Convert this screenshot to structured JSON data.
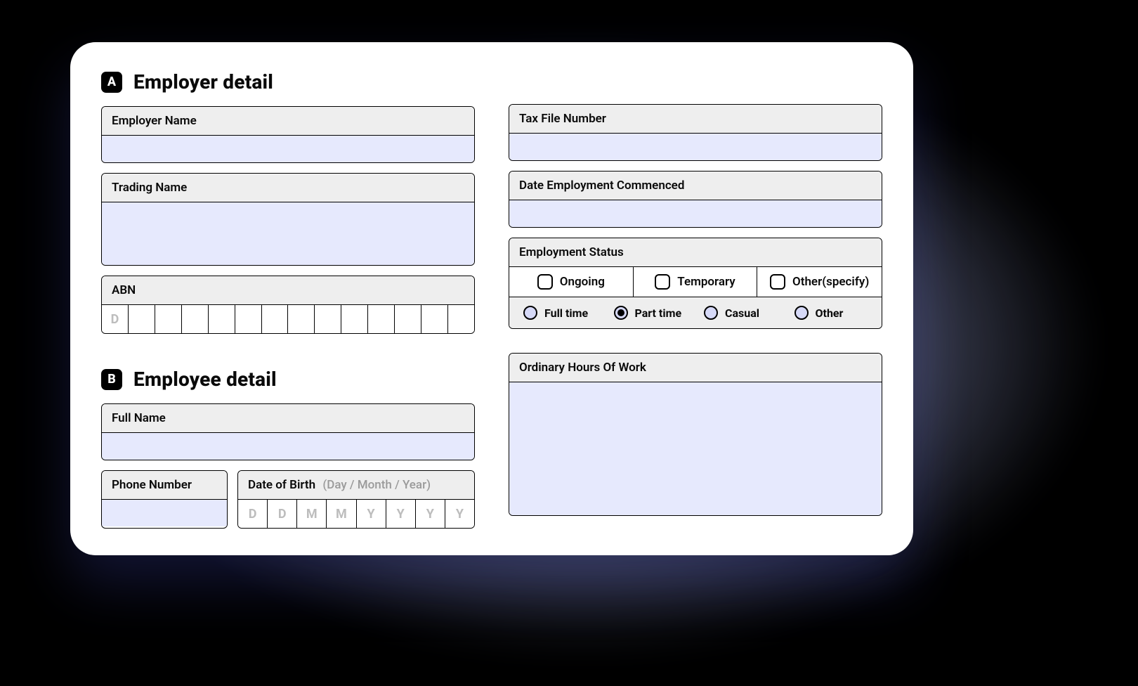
{
  "sections": {
    "A": {
      "badge": "A",
      "title": "Employer detail"
    },
    "B": {
      "badge": "B",
      "title": "Employee detail"
    }
  },
  "fields": {
    "employerName": {
      "label": "Employer Name",
      "value": ""
    },
    "tradingName": {
      "label": "Trading Name",
      "value": ""
    },
    "abn": {
      "label": "ABN",
      "placeholder0": "D"
    },
    "taxFileNumber": {
      "label": "Tax File Number",
      "value": ""
    },
    "dateCommenced": {
      "label": "Date Employment Commenced",
      "value": ""
    },
    "employmentStatus": {
      "label": "Employment Status",
      "checks": [
        {
          "label": "Ongoing",
          "checked": false
        },
        {
          "label": "Temporary",
          "checked": false
        },
        {
          "label": "Other(specify)",
          "checked": false
        }
      ],
      "radios": [
        {
          "label": "Full time",
          "selected": false
        },
        {
          "label": "Part time",
          "selected": true
        },
        {
          "label": "Casual",
          "selected": false
        },
        {
          "label": "Other",
          "selected": false
        }
      ]
    },
    "fullName": {
      "label": "Full Name",
      "value": ""
    },
    "phone": {
      "label": "Phone Number",
      "value": ""
    },
    "dob": {
      "label": "Date of Birth",
      "hint": "(Day / Month / Year)",
      "placeholders": [
        "D",
        "D",
        "M",
        "M",
        "Y",
        "Y",
        "Y",
        "Y"
      ]
    },
    "ordinaryHours": {
      "label": "Ordinary Hours Of Work",
      "value": ""
    }
  }
}
